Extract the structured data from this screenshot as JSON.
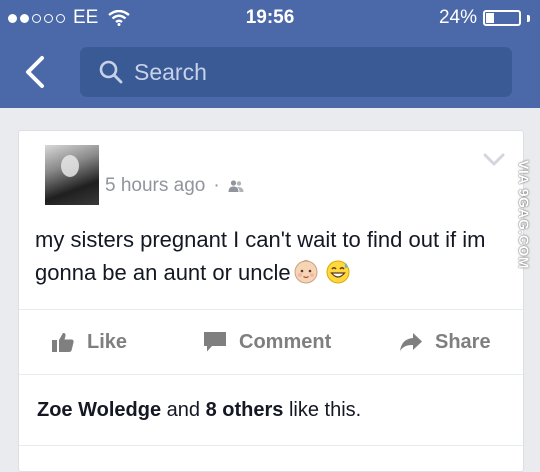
{
  "status_bar": {
    "carrier": "EE",
    "time": "19:56",
    "battery_percent_label": "24%",
    "battery_level": 0.24,
    "signal_bars_filled": 2,
    "signal_bars_total": 5
  },
  "nav": {
    "search_placeholder": "Search",
    "back_icon": "chevron-left-icon",
    "search_icon": "magnifier-icon"
  },
  "post": {
    "timestamp": "5 hours ago",
    "separator": "·",
    "audience_icon": "friends-icon",
    "text": "my sisters pregnant I can't wait to find out if im gonna be an aunt or uncle",
    "emojis": [
      "baby-face-emoji",
      "grinning-sweat-emoji"
    ],
    "actions": {
      "like": "Like",
      "comment": "Comment",
      "share": "Share"
    },
    "likes_summary": {
      "name": "Zoe Woledge",
      "and": " and ",
      "others": "8 others",
      "suffix": " like this."
    }
  },
  "watermark": "VIA 9GAG.COM",
  "colors": {
    "header_blue": "#4b69a8",
    "search_bg": "#3a5a96",
    "background": "#e9ebee",
    "action_gray": "#7f7f7f",
    "meta_gray": "#90949c"
  }
}
